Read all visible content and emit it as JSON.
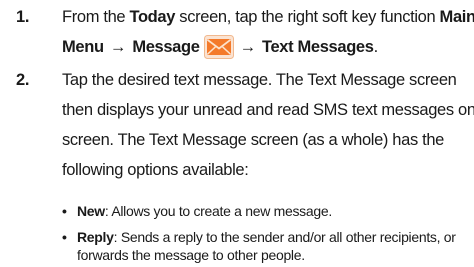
{
  "steps": [
    {
      "number": "1.",
      "line1": {
        "pre": "From the ",
        "today": "Today",
        "mid": " screen, tap the right soft key function ",
        "main": "Main"
      },
      "line2": {
        "menu": "Menu",
        "arrow1": "→",
        "message": "Message",
        "icon": "envelope-icon",
        "arrow2": "→",
        "text_messages": "Text Messages",
        "end": "."
      }
    },
    {
      "number": "2.",
      "lines": [
        "Tap the desired text message. The Text Message screen",
        "then displays your unread and read SMS text messages on",
        "screen. The Text Message screen (as a whole) has the",
        "following options available:"
      ]
    }
  ],
  "bullets": [
    {
      "term": "New",
      "sep": ": ",
      "lines": [
        "Allows you to create a new message."
      ]
    },
    {
      "term": "Reply",
      "sep": ": ",
      "lines": [
        "Sends a reply to the sender and/or all other recipients, or",
        "forwards the message to other people."
      ]
    }
  ],
  "colors": {
    "text": "#1a1a1a",
    "icon_fill": "#f47a2a",
    "icon_bg": "#fbe3d2"
  }
}
